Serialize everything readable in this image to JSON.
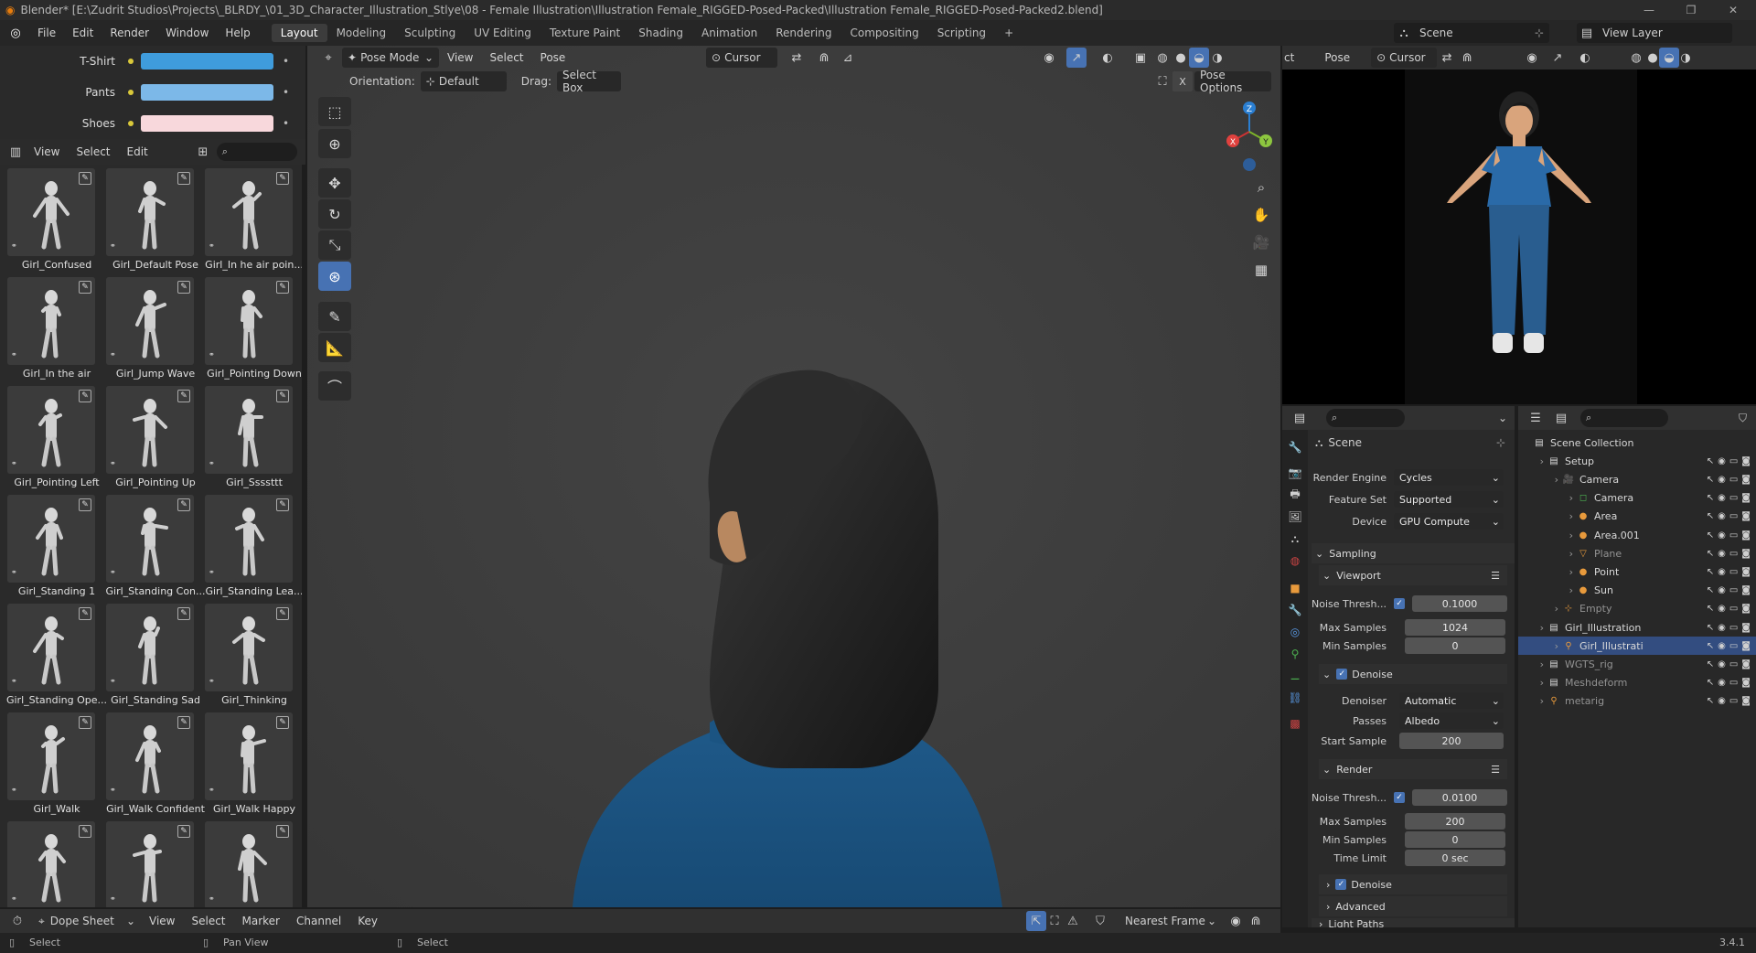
{
  "titlebar": {
    "title": "Blender* [E:\\Zudrit Studios\\Projects\\_BLRDY_\\01_3D_Character_Illustration_Stlye\\08 - Female Illustration\\Illustration Female_RIGGED-Posed-Packed\\Illustration Female_RIGGED-Posed-Packed2.blend]",
    "controls": [
      "—",
      "❐",
      "✕"
    ]
  },
  "menubar": {
    "menus": [
      "File",
      "Edit",
      "Render",
      "Window",
      "Help"
    ],
    "workspaces": [
      "Layout",
      "Modeling",
      "Sculpting",
      "UV Editing",
      "Texture Paint",
      "Shading",
      "Animation",
      "Rendering",
      "Compositing",
      "Scripting"
    ],
    "active_workspace": "Layout",
    "scene_label": "Scene",
    "view_layer_label": "View Layer"
  },
  "color_rows": [
    {
      "label": "T-Shirt",
      "color": "#3f9cdc"
    },
    {
      "label": "Pants",
      "color": "#7cb8e8"
    },
    {
      "label": "Shoes",
      "color": "#f8d8dc"
    }
  ],
  "asset_browser": {
    "menus": [
      "View",
      "Select",
      "Edit"
    ],
    "search_placeholder": "",
    "items": [
      "Girl_Confused",
      "Girl_Default Pose",
      "Girl_In he air poin...",
      "Girl_In the air",
      "Girl_Jump Wave",
      "Girl_Pointing Down",
      "Girl_Pointing Left",
      "Girl_Pointing Up",
      "Girl_Ssssttt",
      "Girl_Standing 1",
      "Girl_Standing Con...",
      "Girl_Standing Lea...",
      "Girl_Standing Ope...",
      "Girl_Standing Sad",
      "Girl_Thinking",
      "Girl_Walk",
      "Girl_Walk Confident",
      "Girl_Walk Happy",
      "",
      "",
      ""
    ]
  },
  "viewport": {
    "mode": "Pose Mode",
    "menus": [
      "View",
      "Select",
      "Pose"
    ],
    "pivot": "Cursor",
    "orientation_label": "Orientation:",
    "orientation_value": "Default",
    "drag_label": "Drag:",
    "drag_value": "Select Box",
    "pose_options": "Pose Options",
    "gizmo": {
      "x": "X",
      "y": "Y",
      "z": "Z"
    }
  },
  "preview": {
    "mode_short": "ct",
    "menu": "Pose",
    "pivot": "Cursor"
  },
  "properties": {
    "scene_title": "Scene",
    "render_engine": {
      "label": "Render Engine",
      "value": "Cycles"
    },
    "feature_set": {
      "label": "Feature Set",
      "value": "Supported"
    },
    "device": {
      "label": "Device",
      "value": "GPU Compute"
    },
    "sampling": "Sampling",
    "viewport_section": "Viewport",
    "vp_noise": {
      "label": "Noise Thresh...",
      "value": "0.1000"
    },
    "vp_max": {
      "label": "Max Samples",
      "value": "1024"
    },
    "vp_min": {
      "label": "Min Samples",
      "value": "0"
    },
    "denoise": "Denoise",
    "denoiser": {
      "label": "Denoiser",
      "value": "Automatic"
    },
    "passes": {
      "label": "Passes",
      "value": "Albedo"
    },
    "start_sample": {
      "label": "Start Sample",
      "value": "200"
    },
    "render_section": "Render",
    "r_noise": {
      "label": "Noise Thresh...",
      "value": "0.0100"
    },
    "r_max": {
      "label": "Max Samples",
      "value": "200"
    },
    "r_min": {
      "label": "Min Samples",
      "value": "0"
    },
    "time_limit": {
      "label": "Time Limit",
      "value": "0 sec"
    },
    "r_denoise": "Denoise",
    "advanced": "Advanced",
    "light_paths": "Light Paths"
  },
  "outliner": {
    "rows": [
      {
        "name": "Scene Collection",
        "indent": 0,
        "icon": "collection"
      },
      {
        "name": "Setup",
        "indent": 1,
        "icon": "collection"
      },
      {
        "name": "Camera",
        "indent": 2,
        "icon": "camera"
      },
      {
        "name": "Camera",
        "indent": 3,
        "icon": "camera-data"
      },
      {
        "name": "Area",
        "indent": 3,
        "icon": "light"
      },
      {
        "name": "Area.001",
        "indent": 3,
        "icon": "light"
      },
      {
        "name": "Plane",
        "indent": 3,
        "icon": "mesh"
      },
      {
        "name": "Point",
        "indent": 3,
        "icon": "light"
      },
      {
        "name": "Sun",
        "indent": 3,
        "icon": "light"
      },
      {
        "name": "Empty",
        "indent": 2,
        "icon": "empty"
      },
      {
        "name": "Girl_Illustration",
        "indent": 1,
        "icon": "collection"
      },
      {
        "name": "Girl_Illustrati",
        "indent": 2,
        "icon": "armature"
      },
      {
        "name": "WGTS_rig",
        "indent": 1,
        "icon": "collection"
      },
      {
        "name": "Meshdeform",
        "indent": 1,
        "icon": "collection"
      },
      {
        "name": "metarig",
        "indent": 1,
        "icon": "armature"
      }
    ]
  },
  "dopesheet": {
    "editor": "Dope Sheet",
    "menus": [
      "View",
      "Select",
      "Marker",
      "Channel",
      "Key"
    ],
    "snap": "Nearest Frame"
  },
  "statusbar": {
    "left": "Select",
    "mid": "Pan View",
    "mid2": "Select",
    "version": "3.4.1"
  }
}
